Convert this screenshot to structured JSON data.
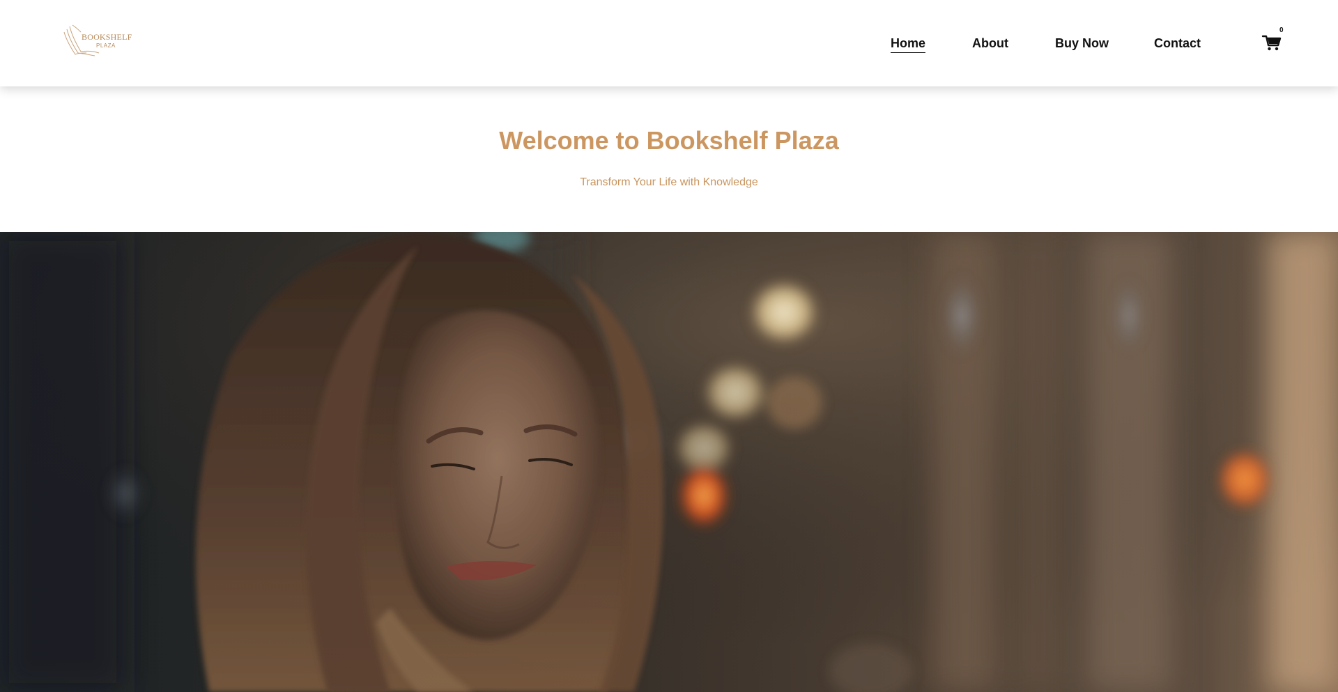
{
  "header": {
    "logo": {
      "title": "BOOKSHELF",
      "subtitle": "PLAZA"
    },
    "nav": [
      {
        "label": "Home",
        "active": true
      },
      {
        "label": "About",
        "active": false
      },
      {
        "label": "Buy Now",
        "active": false
      },
      {
        "label": "Contact",
        "active": false
      }
    ],
    "cart": {
      "icon": "cart-icon",
      "count": "0"
    }
  },
  "intro": {
    "title": "Welcome to Bookshelf Plaza",
    "subtitle": "Transform Your Life with Knowledge"
  },
  "colors": {
    "accent": "#cc9660",
    "nav_text": "#111111"
  }
}
